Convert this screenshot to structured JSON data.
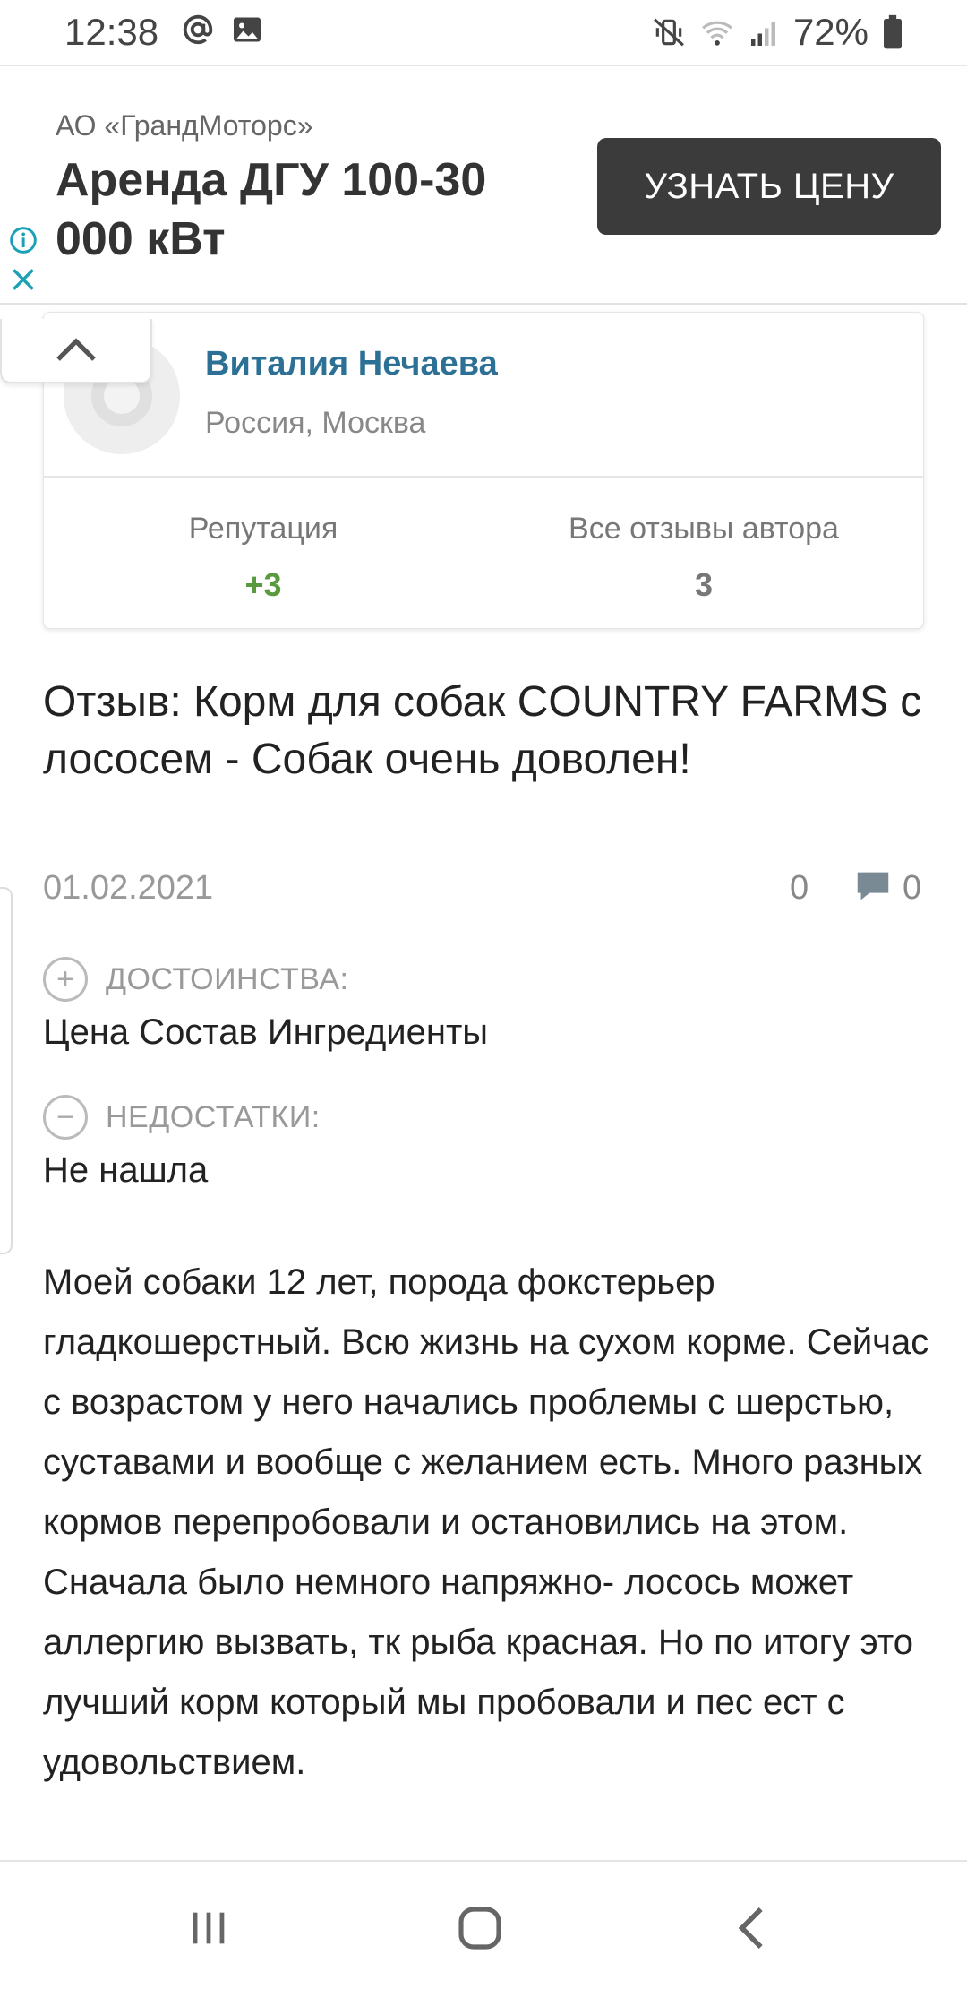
{
  "status_bar": {
    "time": "12:38",
    "battery_percent": "72%",
    "left_icons": [
      "at-sign-icon",
      "image-icon"
    ],
    "right_icons": [
      "mute-vibrate-icon",
      "wifi-icon",
      "signal-icon",
      "battery-icon"
    ]
  },
  "ad": {
    "advertiser": "АО «ГрандМоторс»",
    "title": "Аренда ДГУ 100-30 000 кВт",
    "button_label": "УЗНАТЬ ЦЕНУ",
    "accent_color": "#1aa1b5"
  },
  "author": {
    "name": "Виталия Нечаева",
    "location": "Россия, Москва",
    "reputation_label": "Репутация",
    "reputation_value": "+3",
    "reviews_label": "Все отзывы автора",
    "reviews_value": "3"
  },
  "review": {
    "title": "Отзыв: Корм для собак COUNTRY FARMS с лососем - Собак очень доволен!",
    "date": "01.02.2021",
    "likes": "0",
    "comments": "0",
    "pros_label": "ДОСТОИНСТВА:",
    "pros": "Цена Состав Ингредиенты",
    "cons_label": "НЕДОСТАТКИ:",
    "cons": "Не нашла",
    "body": "Моей собаки 12 лет, порода фокстерьер гладкошерстный. Всю жизнь на сухом корме. Сейчас с возрастом у него начались проблемы с шерстью, суставами и вообще с желанием есть. Много разных кормов перепробовали и остановились на этом. Сначала было немного напряжно- лосось может аллергию вызвать, тк рыба красная. Но по итогу это лучший корм который мы пробовали и пес ест с удовольствием."
  },
  "colors": {
    "author_name": "#2c7195",
    "reputation_positive": "#5a9a3e",
    "ad_button": "#3b3b3b"
  }
}
